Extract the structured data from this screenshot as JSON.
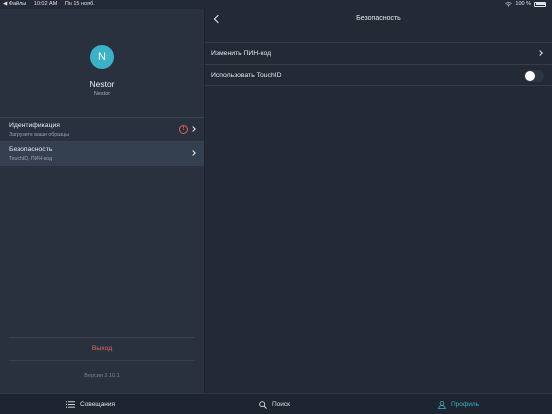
{
  "statusbar": {
    "back_app": "◀ Файлы",
    "time": "10:02 AM",
    "date": "Пн 15 нояб.",
    "battery": "100 %"
  },
  "profile": {
    "avatar_letter": "N",
    "name": "Nestor",
    "subtitle": "Nestor"
  },
  "menu": [
    {
      "title": "Идентификация",
      "subtitle": "Загрузите ваши образцы",
      "warning": "!"
    },
    {
      "title": "Безопасность",
      "subtitle": "TouchID, ПИН-код"
    }
  ],
  "logout_label": "Выход",
  "version": "Версия 2.10.1",
  "security": {
    "title": "Безопасность",
    "rows": [
      {
        "label": "Изменить ПИН-код"
      },
      {
        "label": "Использовать TouchID",
        "toggle_on": false
      }
    ]
  },
  "tabs": [
    {
      "label": "Совещания",
      "icon": "list-icon"
    },
    {
      "label": "Поиск",
      "icon": "search-icon"
    },
    {
      "label": "Профиль",
      "icon": "person-icon",
      "active": true
    }
  ],
  "colors": {
    "accent": "#3ab2c8",
    "logout": "#e06a5a",
    "warning": "#e05a5a"
  }
}
